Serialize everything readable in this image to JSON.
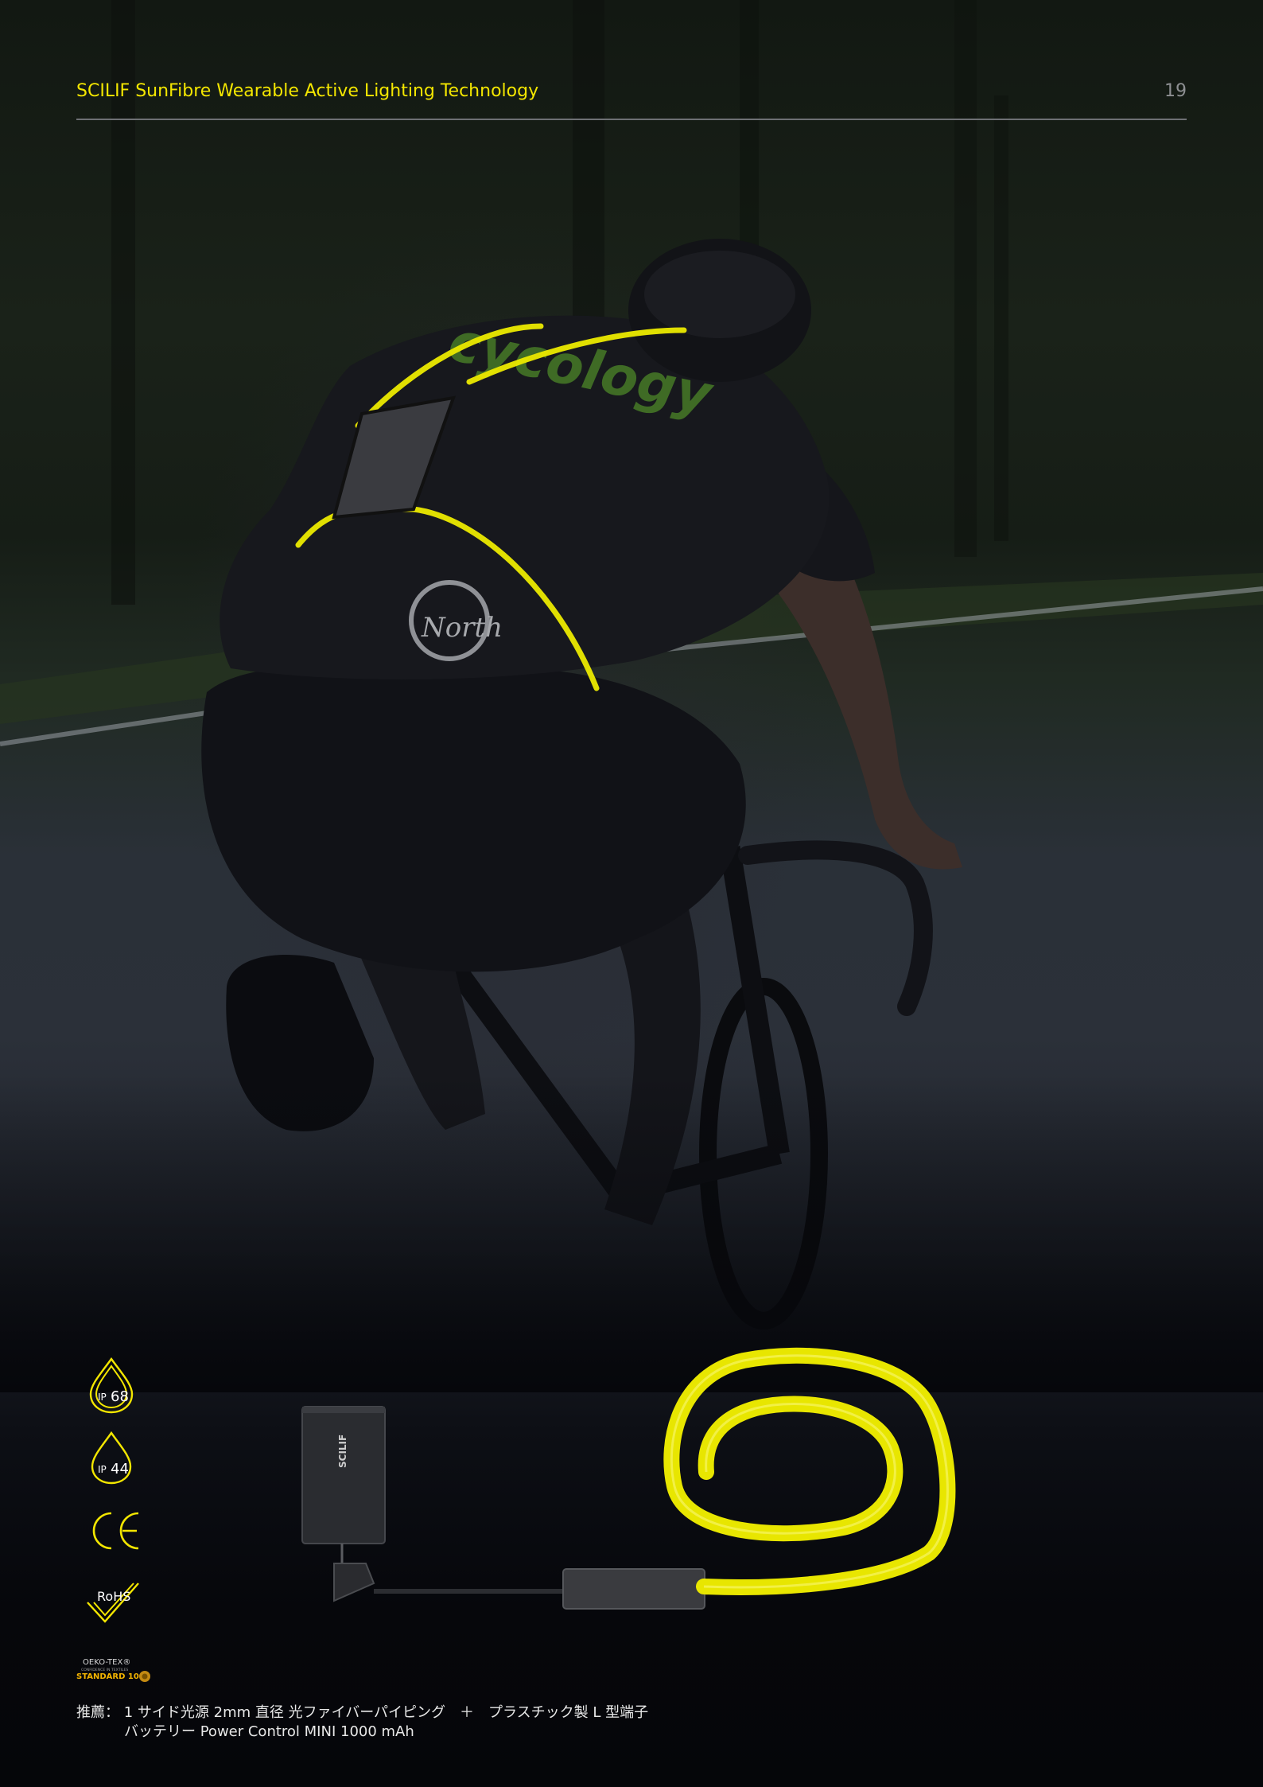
{
  "header": {
    "title": "SCILIF SunFibre Wearable Active Lighting Technology",
    "page_number": "19"
  },
  "certifications": {
    "ip68": "68",
    "ip44": "44",
    "ip_prefix": "IP",
    "ce": "CE",
    "rohs": "RoHS",
    "oeko_line1": "OEKO-TEX®",
    "oeko_line2": "CONFIDENCE IN TEXTILES",
    "oeko_line3": "STANDARD 100"
  },
  "product": {
    "battery_brand": "SCILIF"
  },
  "caption": {
    "line1": "推薦： 1 サイド光源 2mm 直径 光ファイバーパイピング　＋　プラスチック製 L 型端子",
    "line2": "バッテリー Power Control MINI 1000 mAh"
  },
  "colors": {
    "accent_yellow": "#f3e600",
    "fibre_yellow": "#e8e600",
    "background": "#06070b"
  }
}
